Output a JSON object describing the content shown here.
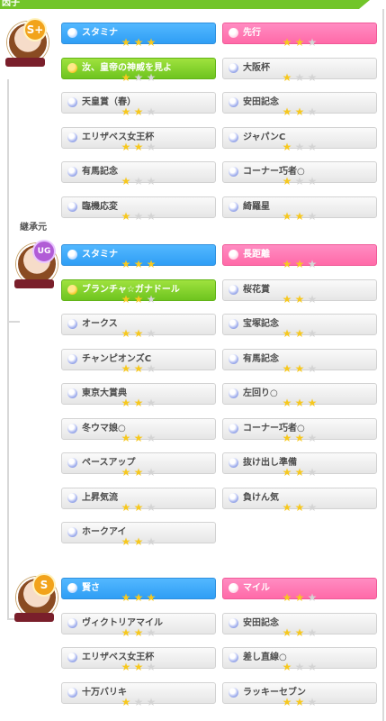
{
  "header": {
    "title": "因子"
  },
  "inherit_label": "継承元",
  "avatars": [
    {
      "rank": "S+"
    },
    {
      "rank": "UG"
    },
    {
      "rank": "S"
    }
  ],
  "sections": [
    {
      "factors": [
        {
          "label": "スタミナ",
          "stars": 3,
          "color": "blue"
        },
        {
          "label": "先行",
          "stars": 2,
          "color": "pink"
        },
        {
          "label": "汝、皇帝の神威を見よ",
          "stars": 1,
          "color": "green"
        },
        {
          "label": "大阪杯",
          "stars": 1,
          "color": "white"
        },
        {
          "label": "天皇賞（春）",
          "stars": 2,
          "color": "white"
        },
        {
          "label": "安田記念",
          "stars": 2,
          "color": "white"
        },
        {
          "label": "エリザベス女王杯",
          "stars": 2,
          "color": "white"
        },
        {
          "label": "ジャパンC",
          "stars": 1,
          "color": "white"
        },
        {
          "label": "有馬記念",
          "stars": 1,
          "color": "white"
        },
        {
          "label": "コーナー巧者○",
          "stars": 1,
          "color": "white"
        },
        {
          "label": "臨機応変",
          "stars": 1,
          "color": "white"
        },
        {
          "label": "綺羅星",
          "stars": 2,
          "color": "white"
        }
      ]
    },
    {
      "factors": [
        {
          "label": "スタミナ",
          "stars": 3,
          "color": "blue"
        },
        {
          "label": "長距離",
          "stars": 2,
          "color": "pink"
        },
        {
          "label": "ブランチャ☆ガナドール",
          "stars": 2,
          "color": "green"
        },
        {
          "label": "桜花賞",
          "stars": 2,
          "color": "white"
        },
        {
          "label": "オークス",
          "stars": 2,
          "color": "white"
        },
        {
          "label": "宝塚記念",
          "stars": 2,
          "color": "white"
        },
        {
          "label": "チャンピオンズC",
          "stars": 2,
          "color": "white"
        },
        {
          "label": "有馬記念",
          "stars": 2,
          "color": "white"
        },
        {
          "label": "東京大賞典",
          "stars": 2,
          "color": "white"
        },
        {
          "label": "左回り○",
          "stars": 3,
          "color": "white"
        },
        {
          "label": "冬ウマ娘○",
          "stars": 2,
          "color": "white"
        },
        {
          "label": "コーナー巧者○",
          "stars": 2,
          "color": "white"
        },
        {
          "label": "ペースアップ",
          "stars": 2,
          "color": "white"
        },
        {
          "label": "抜け出し準備",
          "stars": 2,
          "color": "white"
        },
        {
          "label": "上昇気流",
          "stars": 2,
          "color": "white"
        },
        {
          "label": "負けん気",
          "stars": 2,
          "color": "white"
        },
        {
          "label": "ホークアイ",
          "stars": 2,
          "color": "white"
        }
      ]
    },
    {
      "factors": [
        {
          "label": "賢さ",
          "stars": 3,
          "color": "blue"
        },
        {
          "label": "マイル",
          "stars": 2,
          "color": "pink"
        },
        {
          "label": "ヴィクトリアマイル",
          "stars": 2,
          "color": "white"
        },
        {
          "label": "安田記念",
          "stars": 2,
          "color": "white"
        },
        {
          "label": "エリザベス女王杯",
          "stars": 2,
          "color": "white"
        },
        {
          "label": "差し直線○",
          "stars": 1,
          "color": "white"
        },
        {
          "label": "十万バリキ",
          "stars": 1,
          "color": "white"
        },
        {
          "label": "ラッキーセブン",
          "stars": 2,
          "color": "white"
        }
      ]
    }
  ]
}
